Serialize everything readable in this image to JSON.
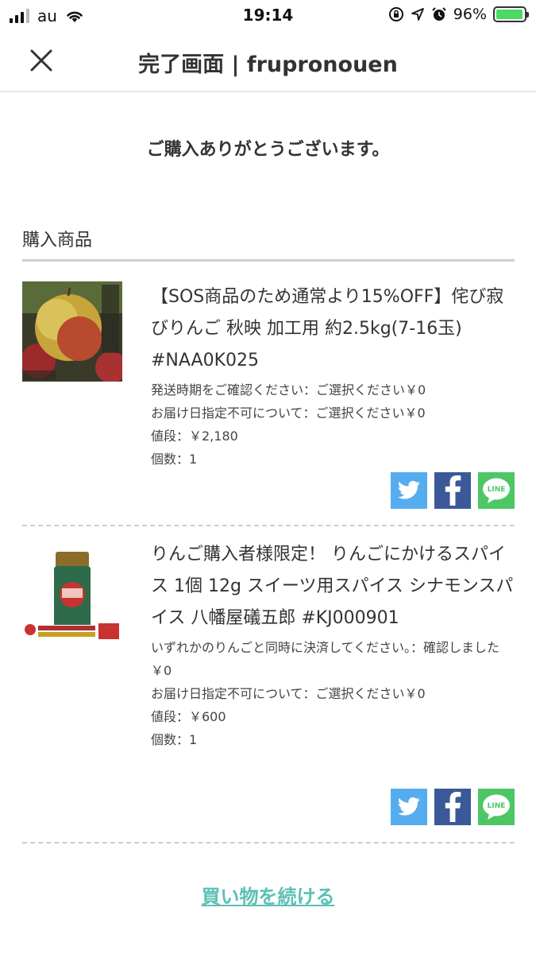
{
  "status_bar": {
    "carrier": "au",
    "time": "19:14",
    "battery": "96%",
    "battery_level": 0.96
  },
  "header": {
    "title": "完了画面 | frupronouen",
    "close_icon": "close-icon"
  },
  "thanks_message": "ご購入ありがとうございます。",
  "section_title": "購入商品",
  "products": [
    {
      "name": "【SOS商品のため通常より15%OFF】侘び寂びりんご 秋映 加工用 約2.5kg(7-16玉) #NAA0K025",
      "options": [
        "発送時期をご確認ください：ご選択ください￥0",
        "お届け日指定不可について：ご選択ください￥0"
      ],
      "price": "値段：￥2,180",
      "quantity": "個数：1"
    },
    {
      "name": "りんご購入者様限定！ りんごにかけるスパイス 1個 12g スイーツ用スパイス シナモンスパイス 八幡屋礒五郎 #KJ000901",
      "options": [
        "いずれかのりんごと同時に決済してください。：確認しました￥0",
        "お届け日指定不可について：ご選択ください￥0"
      ],
      "price": "値段：￥600",
      "quantity": "個数：1"
    }
  ],
  "share": {
    "twitter_icon": "twitter-icon",
    "facebook_icon": "facebook-icon",
    "line_label": "LINE"
  },
  "continue_link": "買い物を続ける",
  "colors": {
    "accent": "#5bc0b5",
    "twitter": "#55acee",
    "facebook": "#3b5998",
    "line": "#4cc764"
  }
}
